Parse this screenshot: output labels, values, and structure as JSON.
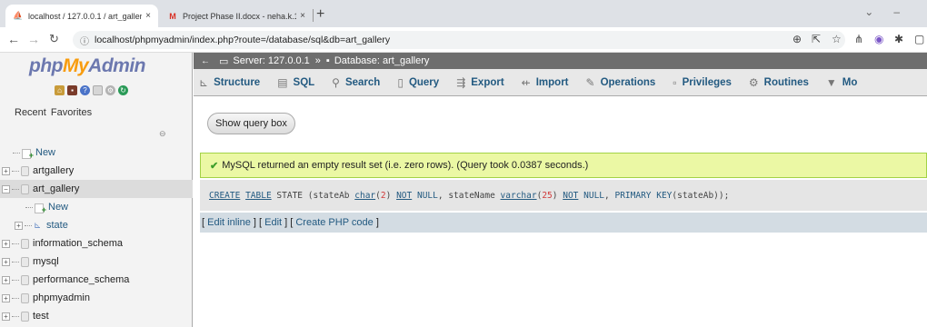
{
  "browser": {
    "tabs": [
      {
        "title": "localhost / 127.0.0.1 / art_gallery",
        "close": "×"
      },
      {
        "title": "Project Phase II.docx - neha.k.16",
        "close": "×"
      }
    ],
    "new_tab": "+",
    "url": "localhost/phpmyadmin/index.php?route=/database/sql&db=art_gallery"
  },
  "nav": {
    "logo": {
      "php": "php",
      "my": "My",
      "admin": "Admin"
    },
    "tabs": [
      "Recent",
      "Favorites"
    ],
    "tree": [
      {
        "label": "New",
        "kind": "new",
        "level": 0
      },
      {
        "label": "artgallery",
        "kind": "db",
        "level": 0
      },
      {
        "label": "art_gallery",
        "kind": "db",
        "level": 0,
        "selected": true,
        "expanded": true
      },
      {
        "label": "New",
        "kind": "new",
        "level": 1
      },
      {
        "label": "state",
        "kind": "table",
        "level": 1
      },
      {
        "label": "information_schema",
        "kind": "db",
        "level": 0
      },
      {
        "label": "mysql",
        "kind": "db",
        "level": 0
      },
      {
        "label": "performance_schema",
        "kind": "db",
        "level": 0
      },
      {
        "label": "phpmyadmin",
        "kind": "db",
        "level": 0
      },
      {
        "label": "test",
        "kind": "db",
        "level": 0
      }
    ]
  },
  "breadcrumb": {
    "server": "Server: 127.0.0.1",
    "separator": "»",
    "database": "Database: art_gallery"
  },
  "main_tabs": [
    {
      "label": "Structure",
      "icon": "structure-icon"
    },
    {
      "label": "SQL",
      "icon": "sql-icon"
    },
    {
      "label": "Search",
      "icon": "search-icon"
    },
    {
      "label": "Query",
      "icon": "query-icon"
    },
    {
      "label": "Export",
      "icon": "export-icon"
    },
    {
      "label": "Import",
      "icon": "import-icon"
    },
    {
      "label": "Operations",
      "icon": "operations-icon"
    },
    {
      "label": "Privileges",
      "icon": "privileges-icon"
    },
    {
      "label": "Routines",
      "icon": "routines-icon"
    },
    {
      "label": "Mo",
      "icon": "more-icon"
    }
  ],
  "show_query_label": "Show query box",
  "message": "MySQL returned an empty result set (i.e. zero rows). (Query took 0.0387 seconds.)",
  "sql": {
    "create": "CREATE",
    "table": "TABLE",
    "name": "STATE",
    "col1": "stateAb",
    "char": "char",
    "n2": "2",
    "not1": "NOT",
    "null1": "NULL",
    "col2": "stateName",
    "varchar": "varchar",
    "n25": "25",
    "not2": "NOT",
    "null2": "NULL",
    "pk": "PRIMARY KEY",
    "pkcol": "stateAb"
  },
  "edit_links": [
    "Edit inline",
    "Edit",
    "Create PHP code"
  ],
  "colors": {
    "success_bg": "#ebf8a4",
    "link": "#235a81",
    "breadcrumb_bg": "#6e6e6e"
  }
}
